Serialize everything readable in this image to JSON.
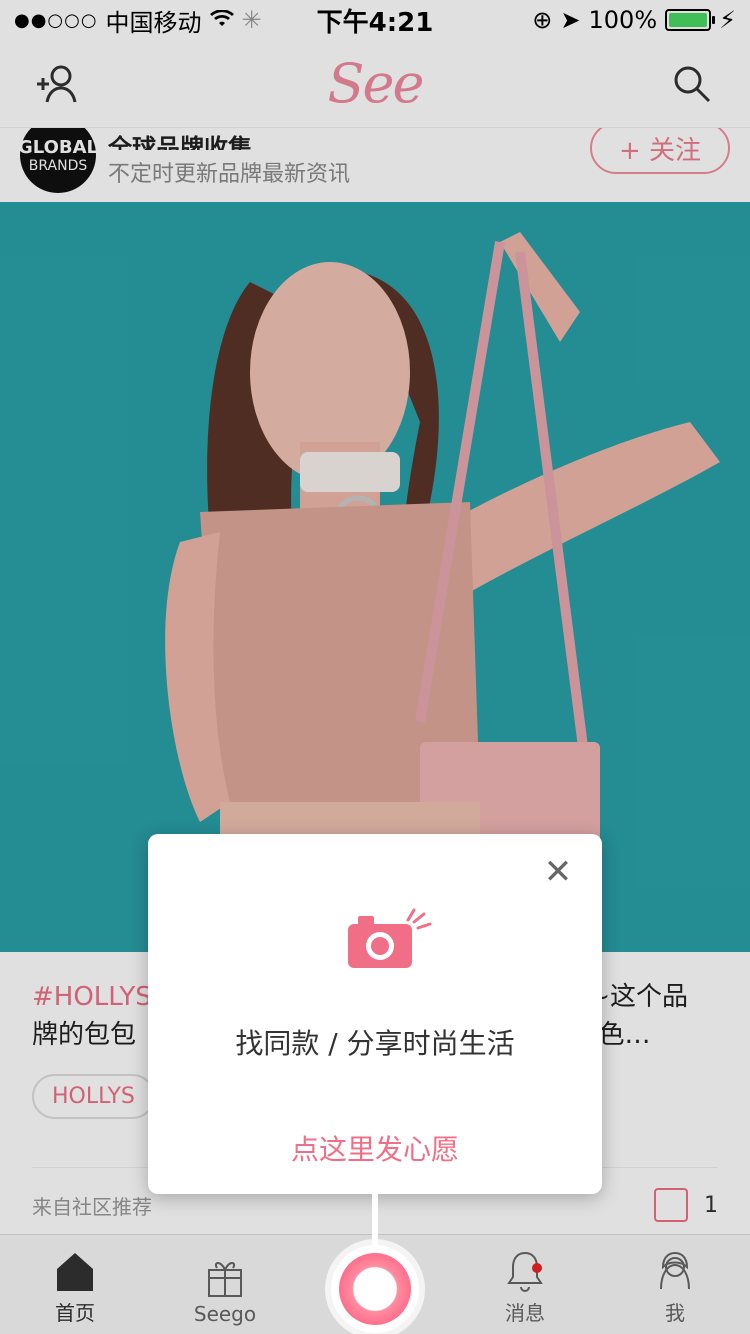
{
  "status_bar": {
    "signal": "●●○○○",
    "carrier": "中国移动",
    "time": "下午4:21",
    "battery_text": "100%"
  },
  "nav": {
    "logo": "See"
  },
  "brand": {
    "avatar_line1": "GLOBAL",
    "avatar_line2": "BRANDS",
    "title": "全球品牌收集",
    "subtitle": "不定时更新品牌最新资讯",
    "follow_label": "+ 关注"
  },
  "card": {
    "text_prefix": "#HOLLYS",
    "text_line1_suffix": "~这个品",
    "text_line2_prefix": "牌的包包",
    "text_line2_suffix": "银色…",
    "tag": "HOLLYS",
    "source": "来自社区推荐",
    "cart_count": "1"
  },
  "popup": {
    "title": "找同款 / 分享时尚生活",
    "cta": "点这里发心愿"
  },
  "tabbar": {
    "items": [
      {
        "label": "首页"
      },
      {
        "label": "Seego"
      },
      {
        "label": ""
      },
      {
        "label": "消息"
      },
      {
        "label": "我"
      }
    ]
  },
  "colors": {
    "accent": "#f06f86",
    "hero_bg": "#2aa0a8"
  }
}
